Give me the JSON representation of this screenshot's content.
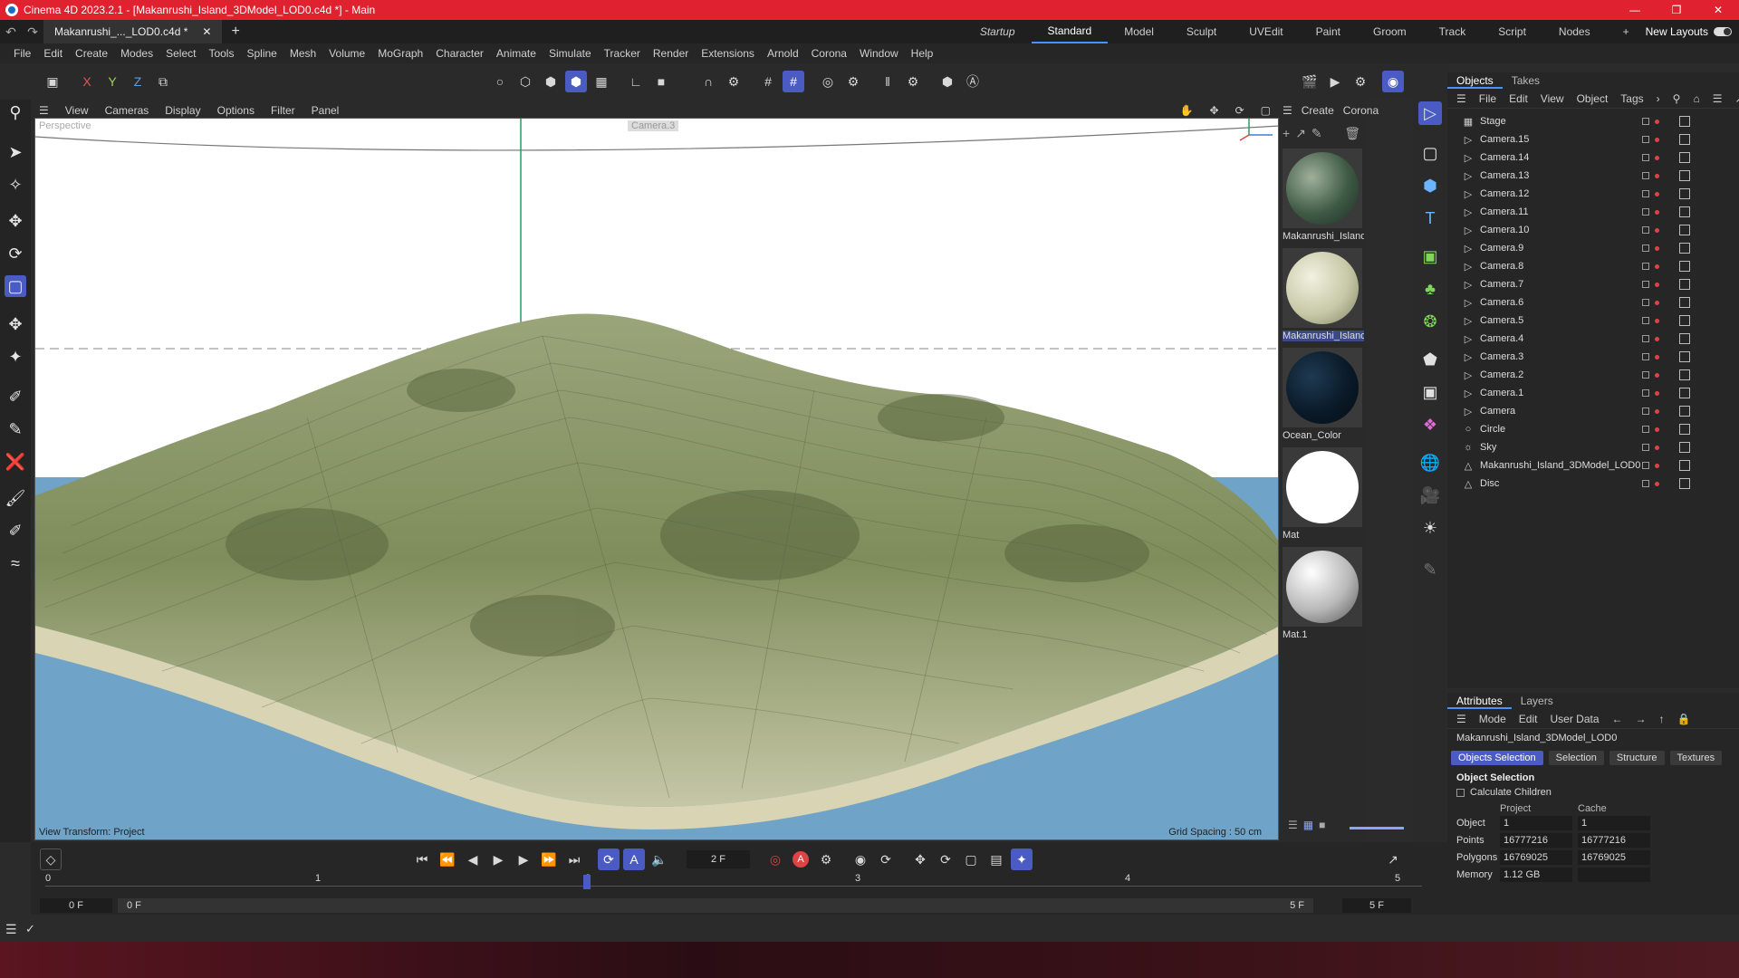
{
  "title": "Cinema 4D 2023.2.1 - [Makanrushi_Island_3DModel_LOD0.c4d *] - Main",
  "doc_tab": "Makanrushi_..._LOD0.c4d *",
  "layouts": [
    "Startup",
    "Standard",
    "Model",
    "Sculpt",
    "UVEdit",
    "Paint",
    "Groom",
    "Track",
    "Script",
    "Nodes"
  ],
  "new_layouts": "New Layouts",
  "menu": [
    "File",
    "Edit",
    "Create",
    "Modes",
    "Select",
    "Tools",
    "Spline",
    "Mesh",
    "Volume",
    "MoGraph",
    "Character",
    "Animate",
    "Simulate",
    "Tracker",
    "Render",
    "Extensions",
    "Arnold",
    "Corona",
    "Window",
    "Help"
  ],
  "axes": {
    "x": "X",
    "y": "Y",
    "z": "Z"
  },
  "viewport": {
    "menu": [
      "View",
      "Cameras",
      "Display",
      "Options",
      "Filter",
      "Panel"
    ],
    "label": "Perspective",
    "camera": "Camera.3",
    "view_transform": "View Transform: Project",
    "grid_spacing": "Grid Spacing : 50 cm"
  },
  "materials": {
    "menu": [
      "Create",
      "Corona"
    ],
    "items": [
      {
        "name": "Makanrushi_Island"
      },
      {
        "name": "Makanrushi_Island"
      },
      {
        "name": "Ocean_Color"
      },
      {
        "name": "Mat"
      },
      {
        "name": "Mat.1"
      }
    ]
  },
  "objects": {
    "tabs": [
      "Objects",
      "Takes"
    ],
    "menu": [
      "File",
      "Edit",
      "View",
      "Object",
      "Tags"
    ],
    "items": [
      {
        "name": "Stage",
        "icon": "stage-icon"
      },
      {
        "name": "Camera.15",
        "icon": "camera-icon"
      },
      {
        "name": "Camera.14",
        "icon": "camera-icon"
      },
      {
        "name": "Camera.13",
        "icon": "camera-icon"
      },
      {
        "name": "Camera.12",
        "icon": "camera-icon"
      },
      {
        "name": "Camera.11",
        "icon": "camera-icon"
      },
      {
        "name": "Camera.10",
        "icon": "camera-icon"
      },
      {
        "name": "Camera.9",
        "icon": "camera-icon"
      },
      {
        "name": "Camera.8",
        "icon": "camera-icon"
      },
      {
        "name": "Camera.7",
        "icon": "camera-icon"
      },
      {
        "name": "Camera.6",
        "icon": "camera-icon"
      },
      {
        "name": "Camera.5",
        "icon": "camera-icon"
      },
      {
        "name": "Camera.4",
        "icon": "camera-icon"
      },
      {
        "name": "Camera.3",
        "icon": "camera-icon"
      },
      {
        "name": "Camera.2",
        "icon": "camera-icon"
      },
      {
        "name": "Camera.1",
        "icon": "camera-icon"
      },
      {
        "name": "Camera",
        "icon": "camera-icon"
      },
      {
        "name": "Circle",
        "icon": "circle-icon"
      },
      {
        "name": "Sky",
        "icon": "sky-icon"
      },
      {
        "name": "Makanrushi_Island_3DModel_LOD0",
        "icon": "polygon-icon"
      },
      {
        "name": "Disc",
        "icon": "polygon-icon"
      }
    ]
  },
  "attributes": {
    "tabs": [
      "Attributes",
      "Layers"
    ],
    "menu": [
      "Mode",
      "Edit",
      "User Data"
    ],
    "object_name": "Makanrushi_Island_3DModel_LOD0",
    "subtabs": [
      "Objects Selection",
      "Selection",
      "Structure",
      "Textures"
    ],
    "section": "Object Selection",
    "calc_children": "Calculate Children",
    "columns": [
      "Project",
      "Cache"
    ],
    "rows": [
      {
        "label": "Object",
        "project": "1",
        "cache": "1"
      },
      {
        "label": "Points",
        "project": "16777216",
        "cache": "16777216"
      },
      {
        "label": "Polygons",
        "project": "16769025",
        "cache": "16769025"
      },
      {
        "label": "Memory",
        "project": "1.12 GB",
        "cache": ""
      }
    ]
  },
  "timeline": {
    "current_frame": "2 F",
    "start_left": "0 F",
    "start_right": "0 F",
    "end_left": "5 F",
    "end_right": "5 F",
    "ruler": [
      "0",
      "1",
      "2",
      "3",
      "4",
      "5"
    ]
  },
  "colors": {
    "accent": "#4a5cc4",
    "titlebar": "#e0212f",
    "ocean": "#6fa3c8",
    "terrain": "#8b9a6a"
  }
}
